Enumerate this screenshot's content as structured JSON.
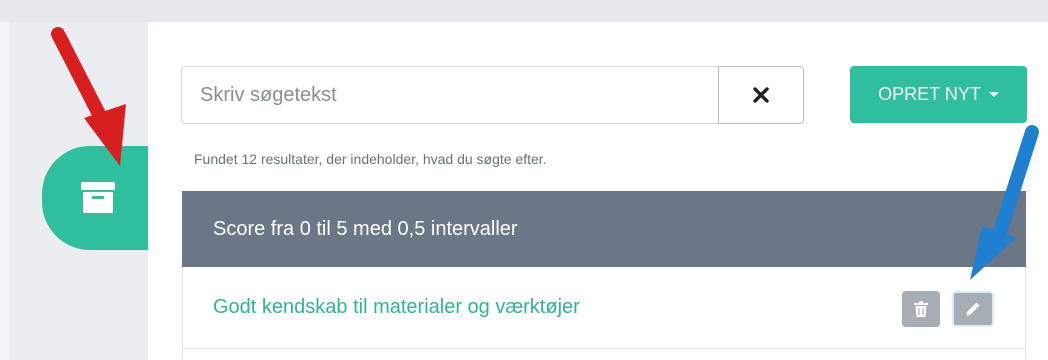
{
  "search": {
    "placeholder": "Skriv søgetekst",
    "value": ""
  },
  "toolbar": {
    "create_label": "OPRET NYT"
  },
  "results": {
    "count_text": "Fundet 12 resultater, der indeholder, hvad du søgte efter."
  },
  "card": {
    "header_title": "Score fra 0 til 5 med 0,5 intervaller",
    "rows": [
      {
        "label": "Godt kendskab til materialer og værktøjer"
      }
    ]
  },
  "icons": {
    "sidebar": "archive-icon",
    "clear": "close-icon",
    "delete": "trash-icon",
    "edit": "pencil-icon",
    "caret": "caret-down-icon"
  },
  "colors": {
    "accent": "#2fbf9f",
    "header": "#6b7787",
    "icon_button": "#a7adb4",
    "link": "#2fb596",
    "annotation_red": "#d81e1e",
    "annotation_blue": "#1f7fd1"
  }
}
